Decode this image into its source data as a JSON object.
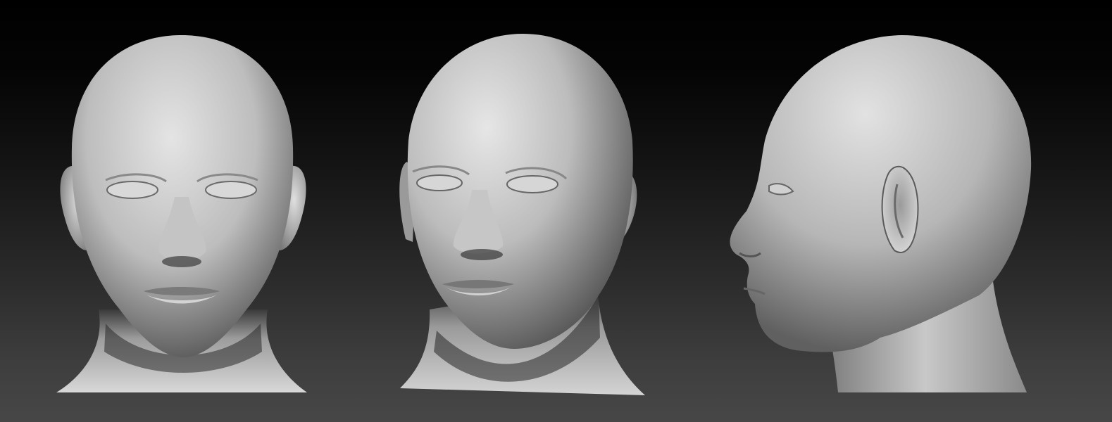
{
  "scene": {
    "background_top": "#000000",
    "background_bottom": "#474747",
    "material_color": "#b8b8b8",
    "views": [
      {
        "id": "front"
      },
      {
        "id": "three-quarter"
      },
      {
        "id": "profile"
      }
    ]
  }
}
